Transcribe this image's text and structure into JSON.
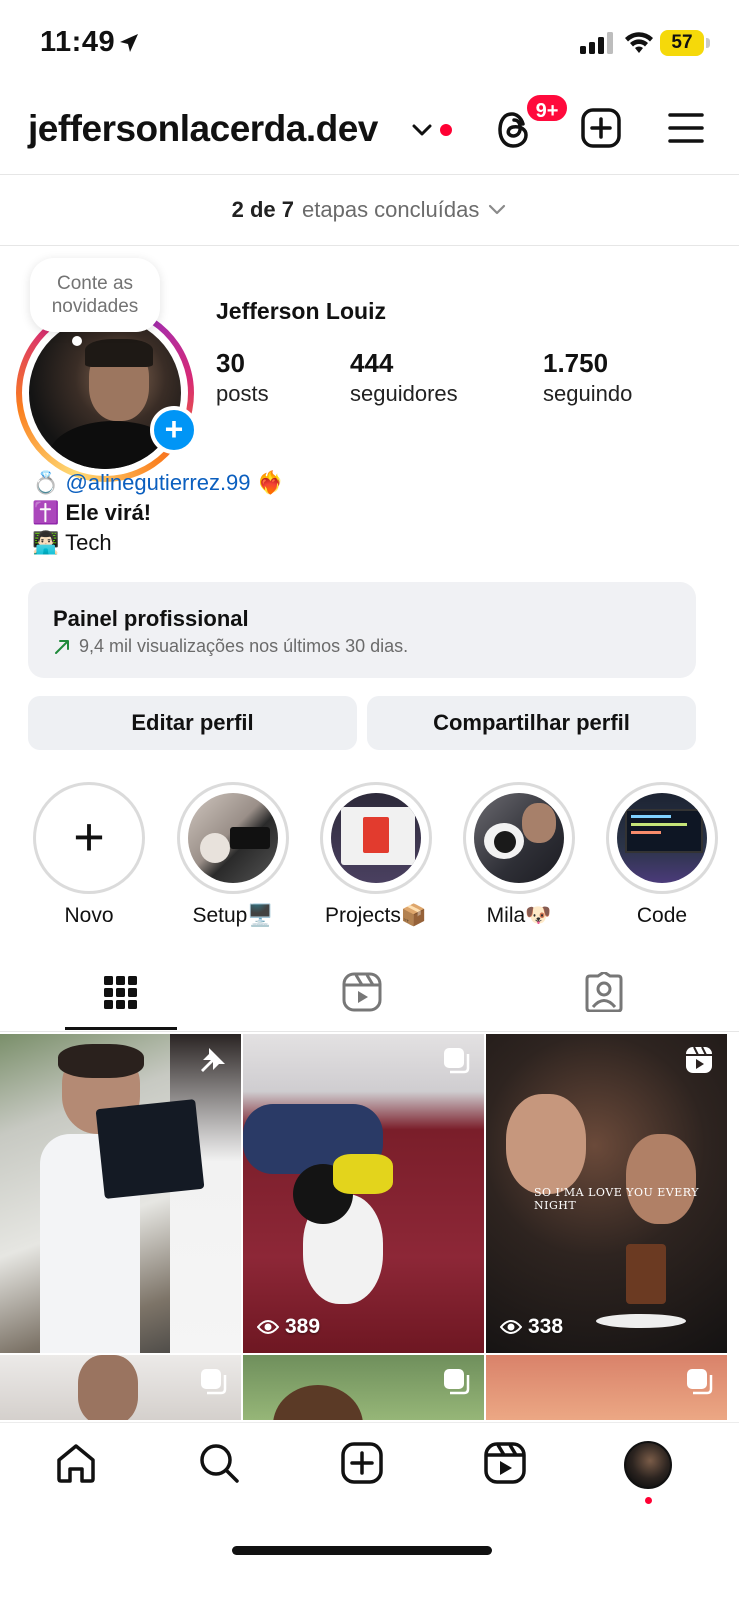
{
  "status_bar": {
    "time": "11:49",
    "battery": "57"
  },
  "header": {
    "username": "jeffersonlacerda.dev",
    "notification_badge": "9+"
  },
  "setup_steps": {
    "done": "2 de 7",
    "label": "etapas concluídas"
  },
  "profile": {
    "note_bubble": "Conte as novidades",
    "full_name": "Jefferson Louiz",
    "stats": [
      {
        "value": "30",
        "label": "posts"
      },
      {
        "value": "444",
        "label": "seguidores"
      },
      {
        "value": "1.750",
        "label": "seguindo"
      }
    ],
    "bio": [
      {
        "emoji": "💍",
        "text": "@alinegutierrez.99",
        "suffix": "❤️‍🔥"
      },
      {
        "emoji": "✝️",
        "text": "Ele virá!"
      },
      {
        "emoji": "👨🏻‍💻",
        "text": "Tech"
      }
    ]
  },
  "professional_panel": {
    "title": "Painel profissional",
    "subtitle": "9,4 mil visualizações nos últimos 30 dias."
  },
  "buttons": {
    "edit": "Editar perfil",
    "share": "Compartilhar perfil"
  },
  "highlights": [
    {
      "label": "Novo"
    },
    {
      "label": "Setup🖥️"
    },
    {
      "label": "Projects📦"
    },
    {
      "label": "Mila🐶"
    },
    {
      "label": "Code"
    }
  ],
  "tabs": [
    "posts-grid",
    "reels",
    "tagged"
  ],
  "grid": [
    {
      "type": "pinned",
      "views": ""
    },
    {
      "type": "carousel",
      "views": "389"
    },
    {
      "type": "reel",
      "views": "338",
      "overlay": "SO I'MA LOVE YOU EVERY NIGHT"
    },
    {
      "type": "carousel",
      "views": ""
    },
    {
      "type": "carousel",
      "views": ""
    },
    {
      "type": "carousel",
      "views": ""
    }
  ],
  "colors": {
    "accent_blue": "#0095f6",
    "notification_red": "#ff0a3c",
    "mention_blue": "#0b5fbf",
    "battery_yellow": "#f5d90a",
    "trend_green": "#1f8a3b"
  }
}
